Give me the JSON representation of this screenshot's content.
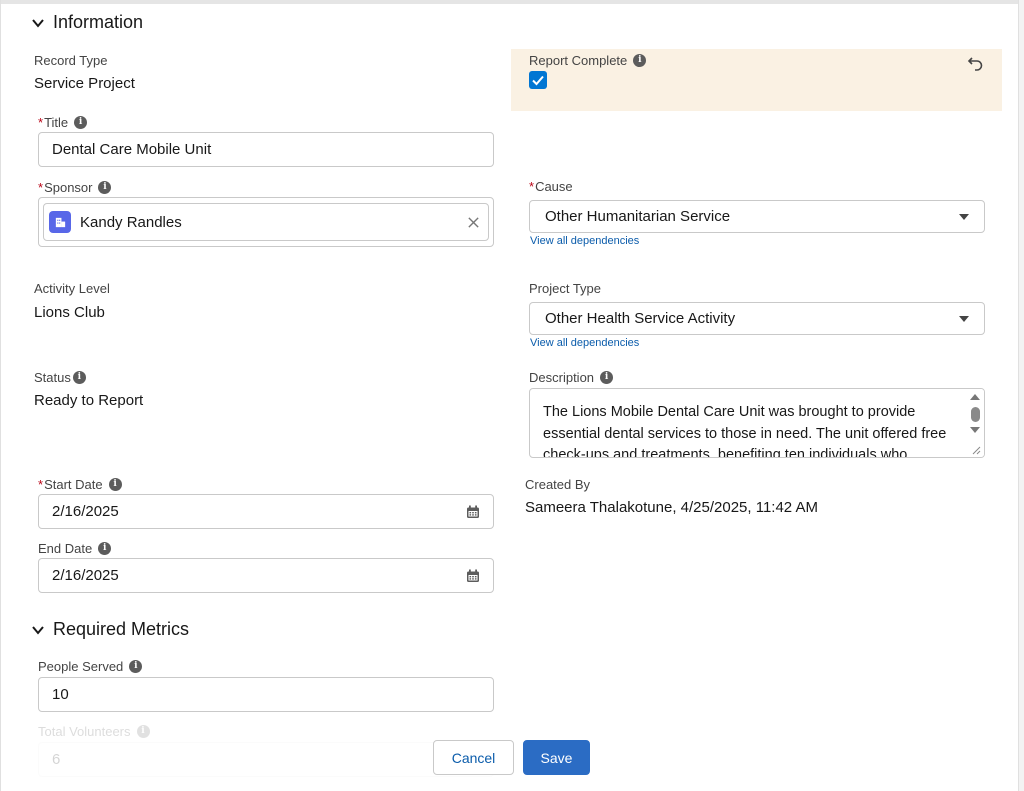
{
  "sections": {
    "information": {
      "title": "Information"
    },
    "required_metrics": {
      "title": "Required Metrics"
    }
  },
  "fields": {
    "record_type": {
      "label": "Record Type",
      "value": "Service Project"
    },
    "report_complete": {
      "label": "Report Complete",
      "checked": true
    },
    "title": {
      "label": "Title",
      "value": "Dental Care Mobile Unit"
    },
    "sponsor": {
      "label": "Sponsor",
      "value": "Kandy Randles"
    },
    "cause": {
      "label": "Cause",
      "value": "Other Humanitarian Service",
      "link": "View all dependencies"
    },
    "activity_level": {
      "label": "Activity Level",
      "value": "Lions Club"
    },
    "project_type": {
      "label": "Project Type",
      "value": "Other Health Service Activity",
      "link": "View all dependencies"
    },
    "status": {
      "label": "Status",
      "value": "Ready to Report"
    },
    "description": {
      "label": "Description",
      "value": "The Lions Mobile Dental Care Unit was brought to provide essential dental services to those in need. The unit offered free check-ups and treatments, benefiting ten individuals who"
    },
    "start_date": {
      "label": "Start Date",
      "value": "2/16/2025"
    },
    "end_date": {
      "label": "End Date",
      "value": "2/16/2025"
    },
    "created_by": {
      "label": "Created By",
      "value": "Sameera Thalakotune, 4/25/2025, 11:42 AM"
    },
    "people_served": {
      "label": "People Served",
      "value": "10"
    },
    "total_volunteers": {
      "label": "Total Volunteers",
      "value": "6"
    }
  },
  "footer": {
    "cancel_label": "Cancel",
    "save_label": "Save"
  },
  "colors": {
    "accent": "#2b6cc4",
    "highlight": "#faf1e3",
    "required": "#ba0517",
    "link": "#0b5cab"
  }
}
